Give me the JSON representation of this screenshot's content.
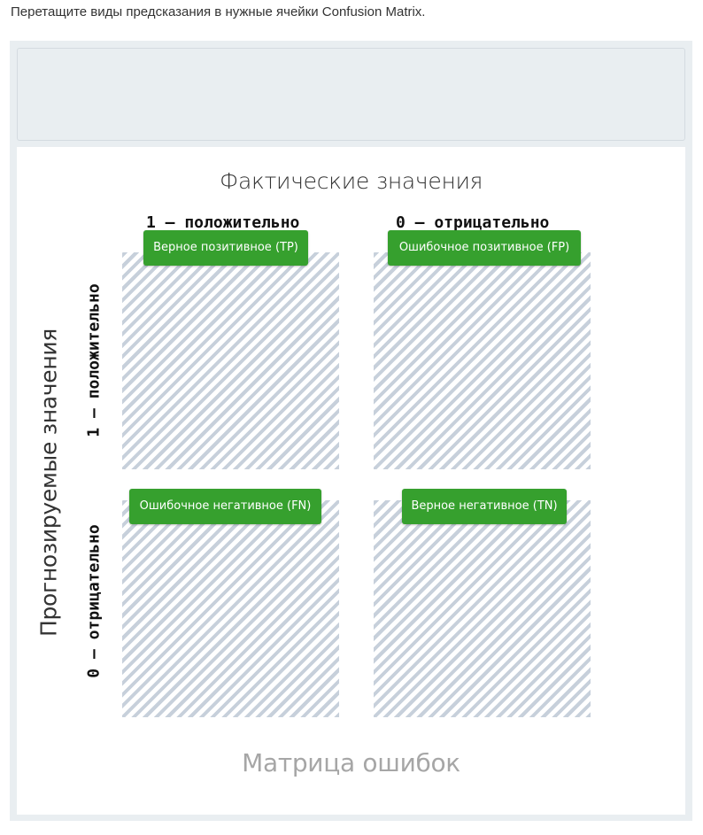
{
  "instruction": "Перетащите виды предсказания в нужные ячейки Confusion Matrix.",
  "matrix": {
    "actual_axis_title": "Фактические значения",
    "predicted_axis_title": "Прогнозируемые значения",
    "columns": [
      {
        "label": "1 — положительно"
      },
      {
        "label": "0 — отрицательно"
      }
    ],
    "rows": [
      {
        "label": "1 — положительно"
      },
      {
        "label": "0 — отрицательно"
      }
    ],
    "caption": "Матрица ошибок"
  },
  "chips": [
    {
      "label": "Верное позитивное (TP)",
      "color": "#36a02e"
    },
    {
      "label": "Ошибочное позитивное (FP)",
      "color": "#36a02e"
    },
    {
      "label": "Ошибочное негативное (FN)",
      "color": "#36a02e"
    },
    {
      "label": "Верное негативное (TN)",
      "color": "#36a02e"
    }
  ],
  "colors": {
    "chip": "#36a02e",
    "hatch": "#c7d0db",
    "panel": "#e9eef1"
  }
}
